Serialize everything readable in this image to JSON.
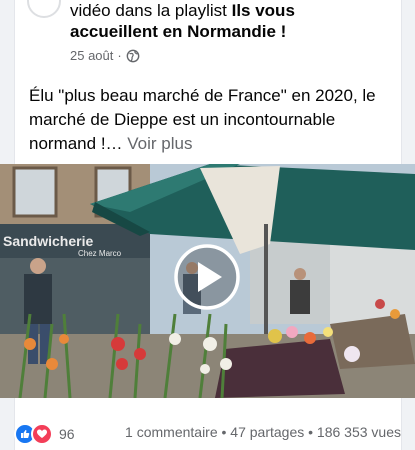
{
  "header": {
    "line1_prefix": "vidéo dans la playlist ",
    "playlist_title_part1": "Ils vous",
    "playlist_title_part2": "accueillent en Normandie !",
    "date": "25 août",
    "separator": "·",
    "privacy_icon": "globe-icon"
  },
  "post": {
    "text": "Élu \"plus beau marché de France\" en 2020, le marché de Dieppe est un incontournable normand !…",
    "see_more": " Voir plus"
  },
  "video": {
    "shop_sign": "Sandwicherie",
    "shop_sign_small": "Chez Marco",
    "play_icon": "play-icon"
  },
  "footer": {
    "reaction_icons": [
      "like-icon",
      "love-icon"
    ],
    "reaction_count": "96",
    "stats": "1 commentaire • 47 partages • 186 353 vues"
  },
  "colors": {
    "like": "#1877f2",
    "love": "#f33e58",
    "text": "#050505",
    "muted": "#65676b"
  }
}
